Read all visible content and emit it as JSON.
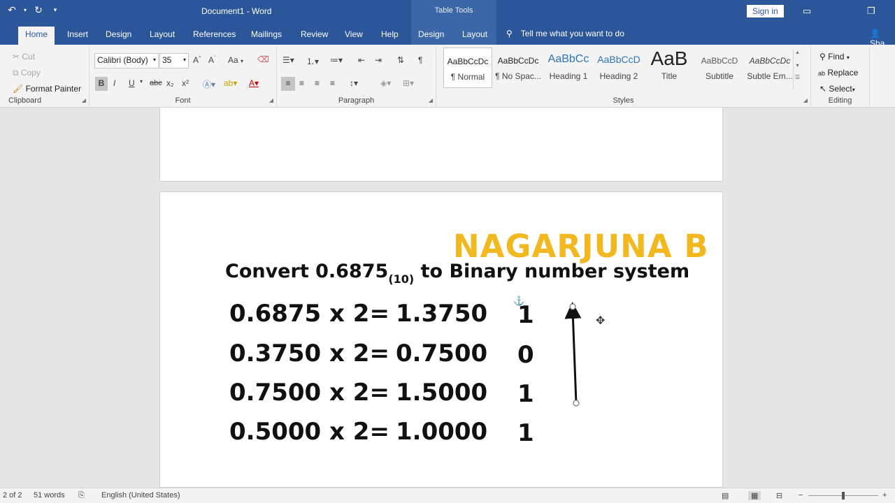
{
  "titlebar": {
    "title": "Document1  -  Word",
    "context": "Table Tools",
    "signin": "Sign in"
  },
  "tabs": {
    "items": [
      "Home",
      "Insert",
      "Design",
      "Layout",
      "References",
      "Mailings",
      "Review",
      "View",
      "Help",
      "Design",
      "Layout"
    ],
    "active": "Home",
    "tellme": "Tell me what you want to do",
    "share": "Sha"
  },
  "ribbon": {
    "clipboard": {
      "cut": "Cut",
      "copy": "Copy",
      "format_painter": "Format Painter",
      "name": "Clipboard"
    },
    "font": {
      "family": "Calibri (Body)",
      "size": "35",
      "name": "Font",
      "aa": "Aa",
      "bold": "B",
      "italic": "I",
      "underline": "U",
      "strike": "abc",
      "sub": "x₂",
      "sup": "x²"
    },
    "paragraph": {
      "name": "Paragraph"
    },
    "styles": {
      "name": "Styles",
      "items": [
        {
          "preview": "AaBbCcDc",
          "label": "¶ Normal"
        },
        {
          "preview": "AaBbCcDc",
          "label": "¶ No Spac..."
        },
        {
          "preview": "AaBbCc",
          "label": "Heading 1"
        },
        {
          "preview": "AaBbCcD",
          "label": "Heading 2"
        },
        {
          "preview": "AaB",
          "label": "Title"
        },
        {
          "preview": "AaBbCcD",
          "label": "Subtitle"
        },
        {
          "preview": "AaBbCcDc",
          "label": "Subtle Em..."
        }
      ]
    },
    "editing": {
      "find": "Find",
      "replace": "Replace",
      "select": "Select",
      "name": "Editing"
    }
  },
  "document": {
    "watermark": "NAGARJUNA B",
    "heading_pre": "Convert 0.6875",
    "heading_sub": "(10)",
    "heading_post": " to Binary number system",
    "rows": [
      {
        "expr": "0.6875 x 2=",
        "result": "1.3750",
        "bit": "1"
      },
      {
        "expr": "0.3750 x 2=",
        "result": "0.7500",
        "bit": "0"
      },
      {
        "expr": "0.7500 x 2=",
        "result": "1.5000",
        "bit": "1"
      },
      {
        "expr": "0.5000 x 2=",
        "result": "1.0000",
        "bit": "1"
      }
    ]
  },
  "status": {
    "page": "2 of 2",
    "words": "51 words",
    "language": "English (United States)"
  },
  "colors": {
    "titlebar": "#2b579a",
    "watermark": "#f2b81f"
  }
}
